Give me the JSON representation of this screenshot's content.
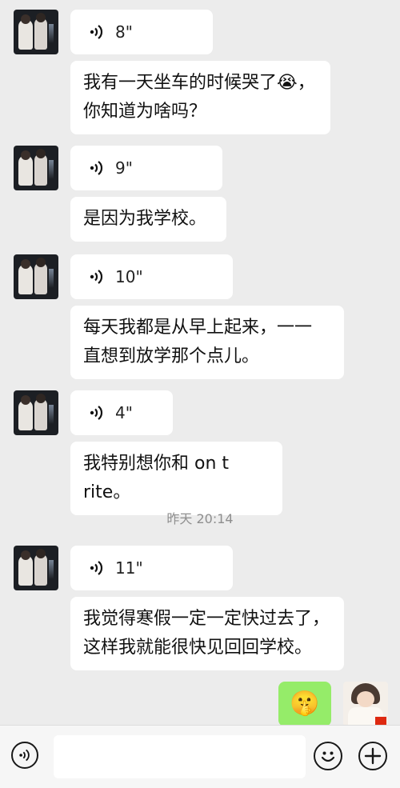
{
  "messages": [
    {
      "voice_duration": "8\"",
      "text": "我有一天坐车的时候哭了😭，\n你知道为啥吗？"
    },
    {
      "voice_duration": "9\"",
      "text": "是因为我学校。"
    },
    {
      "voice_duration": "10\"",
      "text": "每天我都是从早上起来，一一\n直想到放学那个点儿。"
    },
    {
      "voice_duration": "4\"",
      "text": "我特别想你和 on t rite。"
    },
    {
      "voice_duration": "11\"",
      "text": "我觉得寒假一定一定快过去了，\n这样我就能很快见回回学校。"
    }
  ],
  "timestamp": "昨天 20:14",
  "my_message": {
    "emoji": "🤫"
  },
  "input_bar": {
    "placeholder": ""
  },
  "colors": {
    "background": "#ececec",
    "my_bubble": "#95ec69",
    "other_bubble": "#ffffff",
    "timestamp": "#8e8e8e"
  },
  "icons": [
    "voice-wave-icon",
    "voice-input-icon",
    "emoji-icon",
    "plus-icon"
  ]
}
